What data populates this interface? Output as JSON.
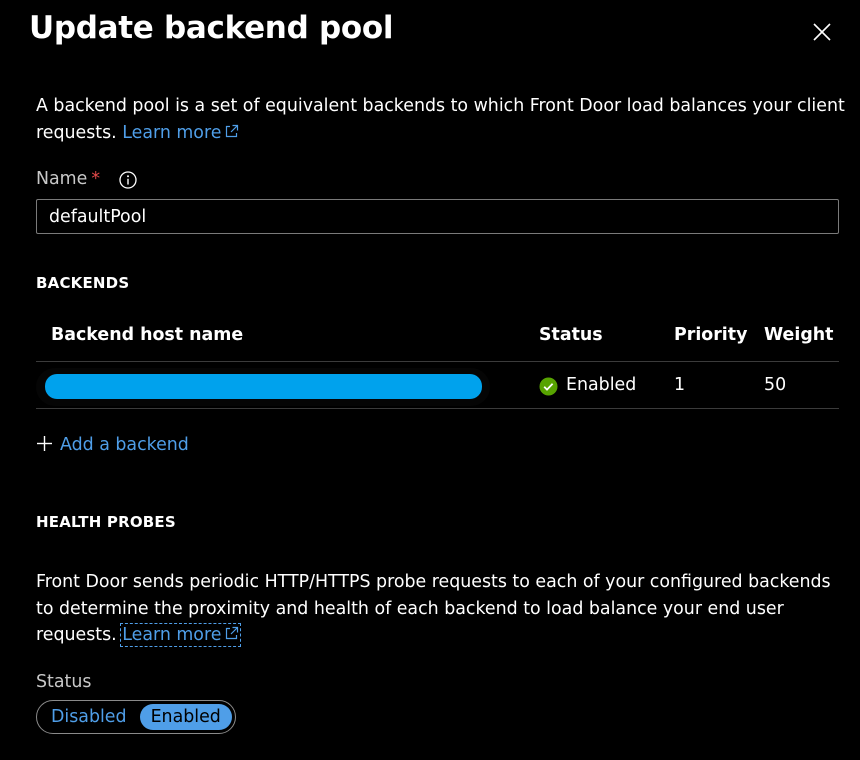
{
  "panel": {
    "title": "Update backend pool",
    "description": "A backend pool is a set of equivalent backends to which Front Door load balances your client requests.",
    "learn_more": "Learn more"
  },
  "name_field": {
    "label": "Name",
    "required_mark": "*",
    "value": "defaultPool"
  },
  "backends": {
    "section_title": "BACKENDS",
    "columns": [
      "Backend host name",
      "Status",
      "Priority",
      "Weight"
    ],
    "rows": [
      {
        "status": "Enabled",
        "priority": "1",
        "weight": "50"
      }
    ],
    "add_label": "Add a backend"
  },
  "health_probes": {
    "section_title": "HEALTH PROBES",
    "description": "Front Door sends periodic HTTP/HTTPS probe requests to each of your configured backends to determine the proximity and health of each backend to load balance your end user requests.",
    "learn_more": "Learn more",
    "status_label": "Status",
    "status_options": [
      "Disabled",
      "Enabled"
    ],
    "status_selected": "Enabled"
  },
  "colors": {
    "background": "#000000",
    "link": "#4f9ee8",
    "required": "#e24a4a",
    "success": "#57a300",
    "redaction": "#00a2ed"
  }
}
